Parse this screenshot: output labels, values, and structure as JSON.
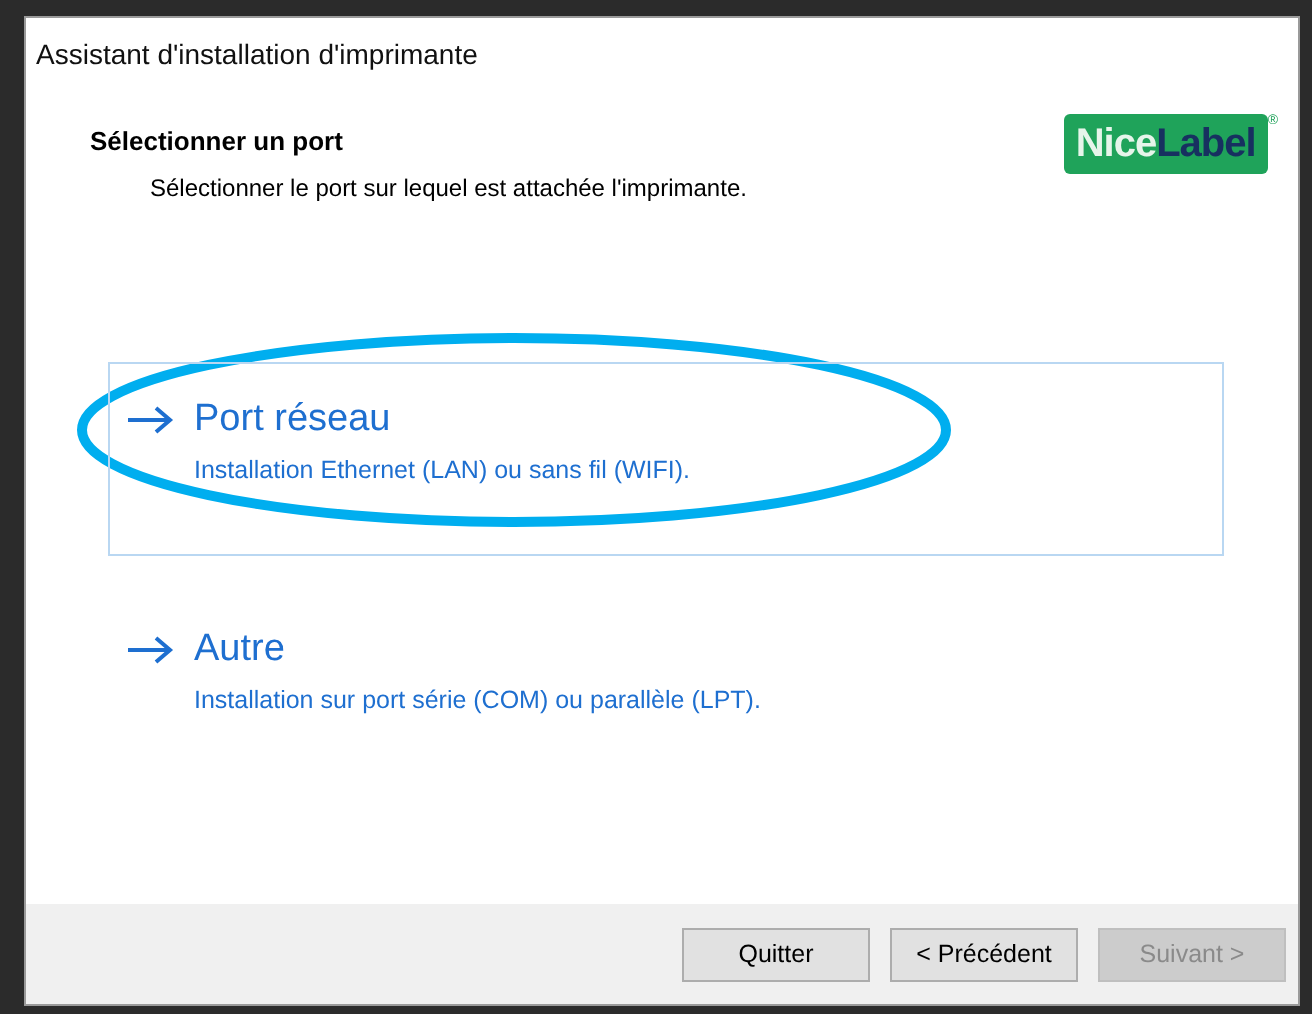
{
  "window": {
    "title": "Assistant d'installation d'imprimante"
  },
  "header": {
    "title": "Sélectionner un port",
    "subtitle": "Sélectionner le port sur lequel est attachée l'imprimante.",
    "logo": {
      "part_1": "Nice",
      "part_2": "Label",
      "mark": "®"
    }
  },
  "options": [
    {
      "title": "Port réseau",
      "description": "Installation Ethernet (LAN) ou sans fil (WIFI).",
      "selected": true,
      "circled": true
    },
    {
      "title": "Autre",
      "description": "Installation sur port série (COM) ou parallèle (LPT).",
      "selected": false,
      "circled": false
    }
  ],
  "buttons": [
    {
      "label": "Quitter",
      "disabled": false
    },
    {
      "label": "< Précédent",
      "disabled": false
    },
    {
      "label": "Suivant >",
      "disabled": true
    }
  ]
}
